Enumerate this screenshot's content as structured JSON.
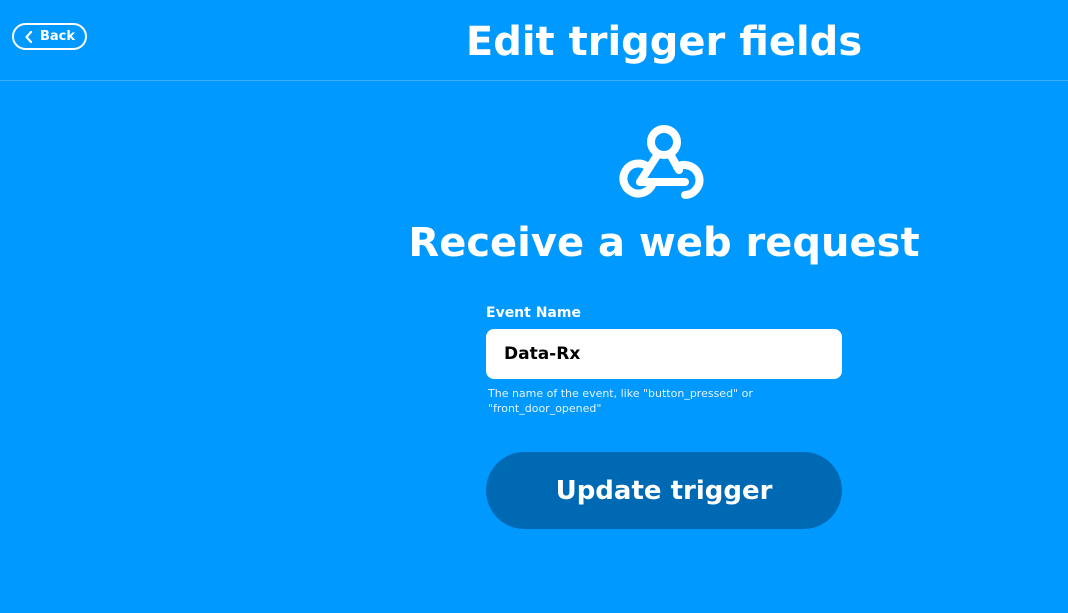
{
  "header": {
    "back_label": "Back",
    "title": "Edit trigger fields"
  },
  "trigger": {
    "icon": "webhook-icon",
    "title": "Receive a web request"
  },
  "form": {
    "event_name_label": "Event Name",
    "event_name_value": "Data-Rx",
    "event_name_helper": "The name of the event, like \"button_pressed\" or \"front_door_opened\"",
    "submit_label": "Update trigger"
  },
  "colors": {
    "background": "#0099ff",
    "button": "#0069b4",
    "text": "#ffffff"
  }
}
